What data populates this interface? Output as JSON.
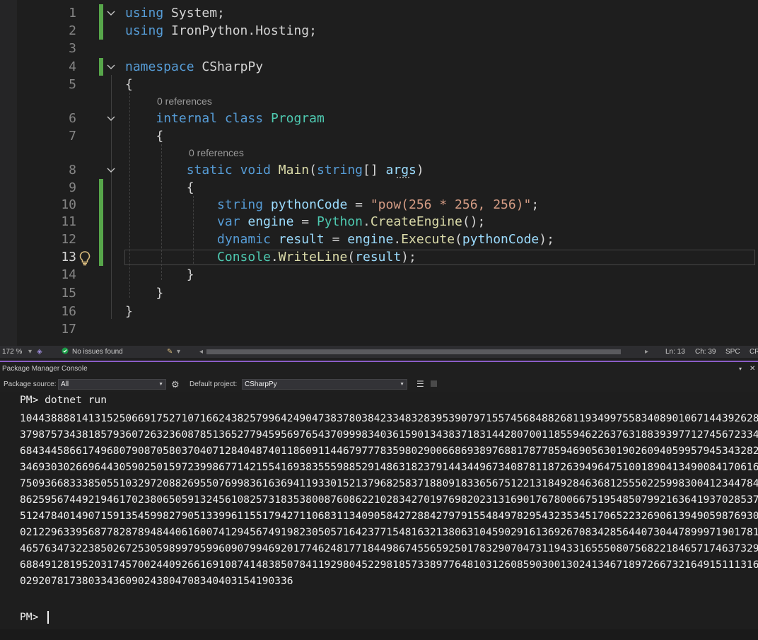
{
  "editor": {
    "lines": [
      {
        "n": "1",
        "tokens": [
          [
            "k",
            "using"
          ],
          [
            "p",
            " System;"
          ]
        ]
      },
      {
        "n": "2",
        "tokens": [
          [
            "k",
            "using"
          ],
          [
            "p",
            " IronPython.Hosting;"
          ]
        ]
      },
      {
        "n": "3",
        "tokens": []
      },
      {
        "n": "4",
        "tokens": [
          [
            "k",
            "namespace"
          ],
          [
            "p",
            " CSharpPy"
          ]
        ]
      },
      {
        "n": "5",
        "tokens": [
          [
            "p",
            "{"
          ]
        ]
      },
      {
        "n": "6",
        "tokens": [
          [
            "p",
            "    "
          ],
          [
            "k",
            "internal"
          ],
          [
            "p",
            " "
          ],
          [
            "k",
            "class"
          ],
          [
            "p",
            " "
          ],
          [
            "t",
            "Program"
          ]
        ]
      },
      {
        "n": "7",
        "tokens": [
          [
            "p",
            "    {"
          ]
        ]
      },
      {
        "n": "8",
        "tokens": [
          [
            "p",
            "        "
          ],
          [
            "k",
            "static"
          ],
          [
            "p",
            " "
          ],
          [
            "k",
            "void"
          ],
          [
            "p",
            " "
          ],
          [
            "m",
            "Main"
          ],
          [
            "p",
            "("
          ],
          [
            "k",
            "string"
          ],
          [
            "p",
            "[] "
          ],
          [
            "v",
            "args"
          ],
          [
            "p",
            ")"
          ]
        ]
      },
      {
        "n": "9",
        "tokens": [
          [
            "p",
            "        {"
          ]
        ]
      },
      {
        "n": "10",
        "tokens": [
          [
            "p",
            "            "
          ],
          [
            "k",
            "string"
          ],
          [
            "p",
            " "
          ],
          [
            "v",
            "pythonCode"
          ],
          [
            "p",
            " = "
          ],
          [
            "s",
            "\"pow(256 * 256, 256)\""
          ],
          [
            "p",
            ";"
          ]
        ]
      },
      {
        "n": "11",
        "tokens": [
          [
            "p",
            "            "
          ],
          [
            "k",
            "var"
          ],
          [
            "p",
            " "
          ],
          [
            "v",
            "engine"
          ],
          [
            "p",
            " = "
          ],
          [
            "t",
            "Python"
          ],
          [
            "p",
            "."
          ],
          [
            "m",
            "CreateEngine"
          ],
          [
            "p",
            "();"
          ]
        ]
      },
      {
        "n": "12",
        "tokens": [
          [
            "p",
            "            "
          ],
          [
            "k",
            "dynamic"
          ],
          [
            "p",
            " "
          ],
          [
            "v",
            "result"
          ],
          [
            "p",
            " = "
          ],
          [
            "v",
            "engine"
          ],
          [
            "p",
            "."
          ],
          [
            "m",
            "Execute"
          ],
          [
            "p",
            "("
          ],
          [
            "v",
            "pythonCode"
          ],
          [
            "p",
            ");"
          ]
        ]
      },
      {
        "n": "13",
        "tokens": [
          [
            "p",
            "            "
          ],
          [
            "t",
            "Console"
          ],
          [
            "p",
            "."
          ],
          [
            "m",
            "WriteLine"
          ],
          [
            "p",
            "("
          ],
          [
            "v",
            "result"
          ],
          [
            "p",
            ");"
          ]
        ]
      },
      {
        "n": "14",
        "tokens": [
          [
            "p",
            "        }"
          ]
        ]
      },
      {
        "n": "15",
        "tokens": [
          [
            "p",
            "    }"
          ]
        ]
      },
      {
        "n": "16",
        "tokens": [
          [
            "p",
            "}"
          ]
        ]
      },
      {
        "n": "17",
        "tokens": []
      }
    ],
    "references_label_6": "0 references",
    "references_label_8": "0 references"
  },
  "statusbar": {
    "zoom": "172 %",
    "issues": "No issues found",
    "line": "Ln: 13",
    "col": "Ch: 39",
    "spacing": "SPC",
    "eol": "CR"
  },
  "pmc": {
    "title": "Package Manager Console",
    "package_source_label": "Package source:",
    "package_source_value": "All",
    "default_project_label": "Default project:",
    "default_project_value": "CSharpPy",
    "command": "PM> dotnet run",
    "output": "1044388881413152506691752710716624382579964249047383780384233483283953907971557456848826811934997558340890106714439262837987573438185793607263236087851365277945956976543709998340361590134383718314428070011855946226376318839397712745672334684344586617496807908705803704071284048740118609114467977783598029006686938976881787785946905630190260940599579453432823469303026696443059025015972399867714215541693835559885291486318237914434496734087811872639496475100189041349008417061675093668333850551032972088269550769983616369411933015213796825837188091833656751221318492846368125550225998300412344784862595674492194617023806505913245610825731835380087608622102834270197698202313169017678006675195485079921636419370285375124784014907159135459982790513399611551794271106831134090584272884279791554849782954323534517065223269061394905987693002122963395687782878948440616007412945674919823050571642377154816321380631045902916136926708342856440730447899971901781465763473223850267253059899795996090799469201774624817718449867455659250178329070473119433165550807568221846571746373296884912819520317457002440926616910874148385078411929804522981857338977648103126085903001302413467189726673216491511131602920781738033436090243804708340403154190336",
    "prompt": "PM>"
  }
}
